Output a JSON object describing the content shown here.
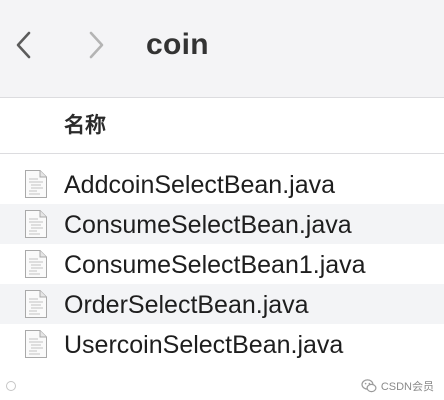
{
  "window": {
    "title": "coin"
  },
  "toolbar": {
    "back_icon": "chevron-left-icon",
    "forward_icon": "chevron-right-icon"
  },
  "list": {
    "column_header": "名称",
    "files": [
      {
        "name": "AddcoinSelectBean.java",
        "icon": "java-file-icon"
      },
      {
        "name": "ConsumeSelectBean.java",
        "icon": "java-file-icon"
      },
      {
        "name": "ConsumeSelectBean1.java",
        "icon": "java-file-icon"
      },
      {
        "name": "OrderSelectBean.java",
        "icon": "java-file-icon"
      },
      {
        "name": "UsercoinSelectBean.java",
        "icon": "java-file-icon"
      }
    ]
  },
  "watermark": {
    "right_text": "CSDN会员"
  },
  "colors": {
    "toolbar_bg": "#f4f4f6",
    "row_alt_bg": "#f3f4f6",
    "divider": "#dcdcdf"
  }
}
